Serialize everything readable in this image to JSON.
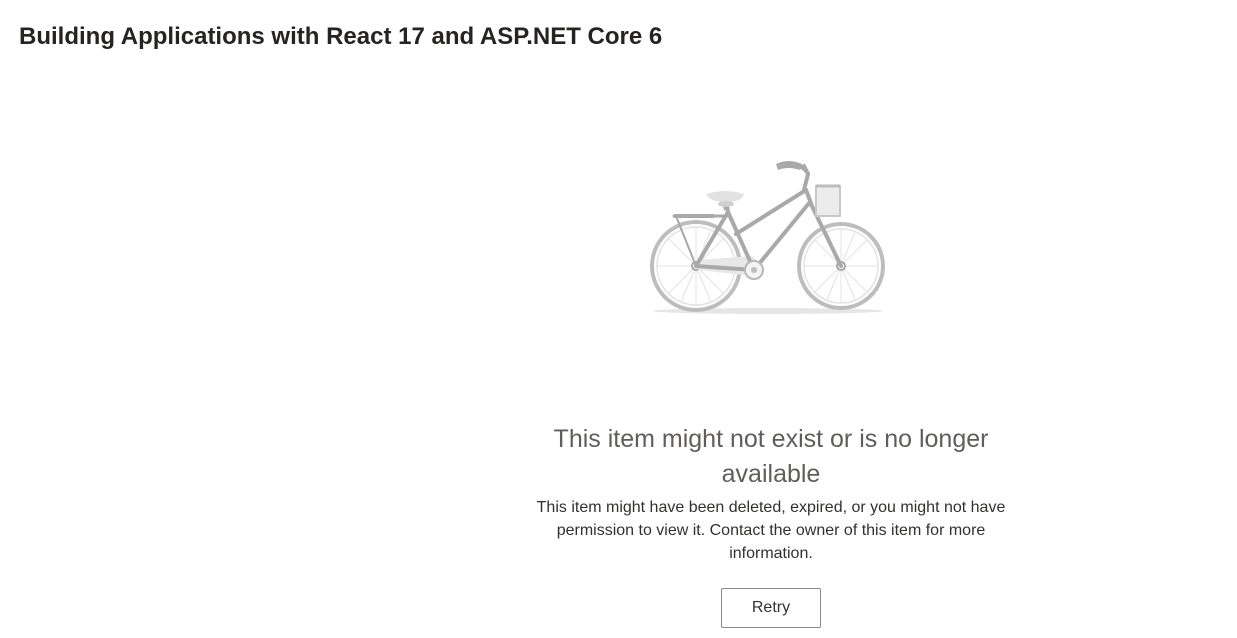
{
  "header": {
    "title": "Building Applications with React 17 and ASP.NET Core 6"
  },
  "illustration": {
    "icon": "bicycle-icon"
  },
  "error": {
    "heading": "This item might not exist or is no longer available",
    "message": "This item might have been deleted, expired, or you might not have permission to view it. Contact the owner of this item for more information.",
    "retry_label": "Retry"
  },
  "colors": {
    "background": "#ffffff",
    "title_text": "#252423",
    "heading_text": "#605e5c",
    "body_text": "#323130",
    "illustration_gray": "#b3b3b3",
    "button_border": "#8a8886"
  }
}
